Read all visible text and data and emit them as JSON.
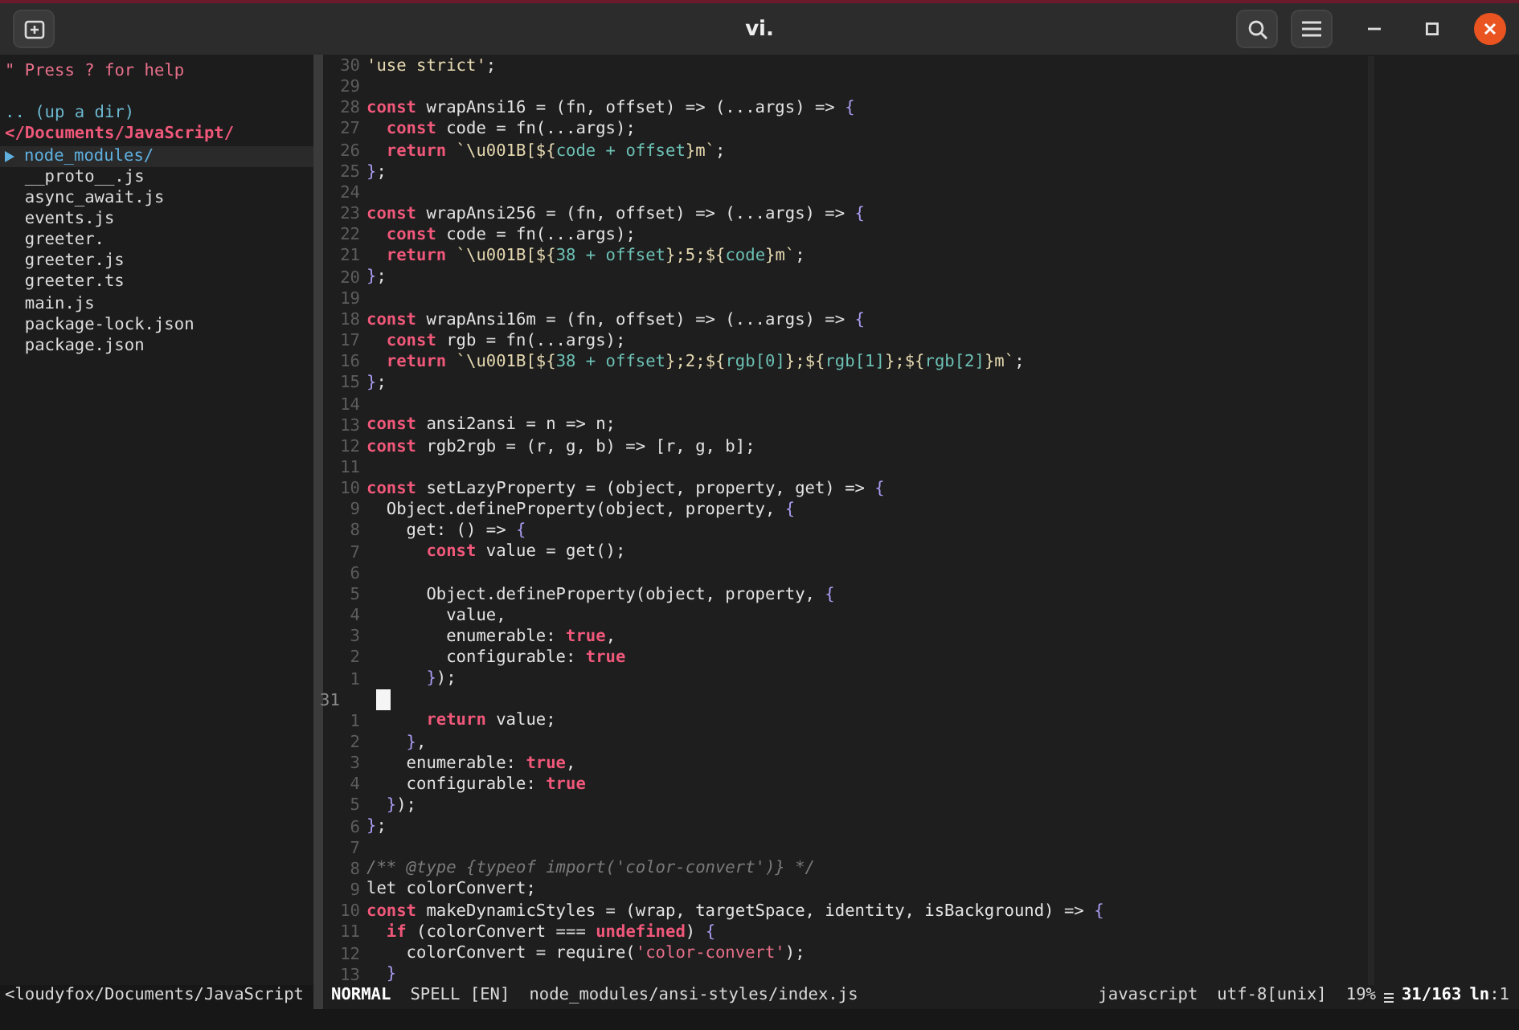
{
  "window": {
    "title": "vi."
  },
  "tree": {
    "help": "\" Press ? for help",
    "up": ".. (up a dir)",
    "root": "</Documents/JavaScript/",
    "items": [
      {
        "name": "node_modules/",
        "kind": "dir",
        "selected": true
      },
      {
        "name": "__proto__.js",
        "kind": "file",
        "selected": false
      },
      {
        "name": "async_await.js",
        "kind": "file",
        "selected": false
      },
      {
        "name": "events.js",
        "kind": "file",
        "selected": false
      },
      {
        "name": "greeter.",
        "kind": "file",
        "selected": false
      },
      {
        "name": "greeter.js",
        "kind": "file",
        "selected": false
      },
      {
        "name": "greeter.ts",
        "kind": "file",
        "selected": false
      },
      {
        "name": "main.js",
        "kind": "file",
        "selected": false
      },
      {
        "name": "package-lock.json",
        "kind": "file",
        "selected": false
      },
      {
        "name": "package.json",
        "kind": "file",
        "selected": false
      }
    ]
  },
  "editor": {
    "lines": [
      {
        "number": "30",
        "cursor": false,
        "tokens": [
          {
            "kind": "str",
            "text": "'use strict'"
          },
          {
            "kind": "pl",
            "text": ";"
          }
        ]
      },
      {
        "number": "29",
        "cursor": false
      },
      {
        "number": "28",
        "cursor": false,
        "tokens": [
          {
            "kind": "kw",
            "text": "const"
          },
          {
            "kind": "pl",
            "text": " wrapAnsi16 = (fn, offset) => (...args) => "
          },
          {
            "kind": "br",
            "text": "{"
          }
        ]
      },
      {
        "number": "27",
        "cursor": false,
        "tokens": [
          {
            "kind": "kw",
            "text": "  const"
          },
          {
            "kind": "pl",
            "text": " code = fn(...args);"
          }
        ]
      },
      {
        "number": "26",
        "cursor": false,
        "tokens": [
          {
            "kind": "kw",
            "text": "  return"
          },
          {
            "kind": "str",
            "text": " `\\u001B[${"
          },
          {
            "kind": "ex",
            "text": "code + offset"
          },
          {
            "kind": "str",
            "text": "}m`"
          },
          {
            "kind": "pl",
            "text": ";"
          }
        ]
      },
      {
        "number": "25",
        "cursor": false,
        "tokens": [
          {
            "kind": "br",
            "text": "}"
          },
          {
            "kind": "pl",
            "text": ";"
          }
        ]
      },
      {
        "number": "24",
        "cursor": false
      },
      {
        "number": "23",
        "cursor": false,
        "tokens": [
          {
            "kind": "kw",
            "text": "const"
          },
          {
            "kind": "pl",
            "text": " wrapAnsi256 = (fn, offset) => (...args) => "
          },
          {
            "kind": "br",
            "text": "{"
          }
        ]
      },
      {
        "number": "22",
        "cursor": false,
        "tokens": [
          {
            "kind": "kw",
            "text": "  const"
          },
          {
            "kind": "pl",
            "text": " code = fn(...args);"
          }
        ]
      },
      {
        "number": "21",
        "cursor": false,
        "tokens": [
          {
            "kind": "kw",
            "text": "  return"
          },
          {
            "kind": "str",
            "text": " `\\u001B[${"
          },
          {
            "kind": "ex",
            "text": "38 + offset"
          },
          {
            "kind": "str",
            "text": "};5;${"
          },
          {
            "kind": "ex",
            "text": "code"
          },
          {
            "kind": "str",
            "text": "}m`"
          },
          {
            "kind": "pl",
            "text": ";"
          }
        ]
      },
      {
        "number": "20",
        "cursor": false,
        "tokens": [
          {
            "kind": "br",
            "text": "}"
          },
          {
            "kind": "pl",
            "text": ";"
          }
        ]
      },
      {
        "number": "19",
        "cursor": false
      },
      {
        "number": "18",
        "cursor": false,
        "tokens": [
          {
            "kind": "kw",
            "text": "const"
          },
          {
            "kind": "pl",
            "text": " wrapAnsi16m = (fn, offset) => (...args) => "
          },
          {
            "kind": "br",
            "text": "{"
          }
        ]
      },
      {
        "number": "17",
        "cursor": false,
        "tokens": [
          {
            "kind": "kw",
            "text": "  const"
          },
          {
            "kind": "pl",
            "text": " rgb = fn(...args);"
          }
        ]
      },
      {
        "number": "16",
        "cursor": false,
        "tokens": [
          {
            "kind": "kw",
            "text": "  return"
          },
          {
            "kind": "str",
            "text": " `\\u001B[${"
          },
          {
            "kind": "ex",
            "text": "38 + offset"
          },
          {
            "kind": "str",
            "text": "};2;${"
          },
          {
            "kind": "ex",
            "text": "rgb[0]"
          },
          {
            "kind": "str",
            "text": "};${"
          },
          {
            "kind": "ex",
            "text": "rgb[1]"
          },
          {
            "kind": "str",
            "text": "};${"
          },
          {
            "kind": "ex",
            "text": "rgb[2]"
          },
          {
            "kind": "str",
            "text": "}m`"
          },
          {
            "kind": "pl",
            "text": ";"
          }
        ]
      },
      {
        "number": "15",
        "cursor": false,
        "tokens": [
          {
            "kind": "br",
            "text": "}"
          },
          {
            "kind": "pl",
            "text": ";"
          }
        ]
      },
      {
        "number": "14",
        "cursor": false
      },
      {
        "number": "13",
        "cursor": false,
        "tokens": [
          {
            "kind": "kw",
            "text": "const"
          },
          {
            "kind": "pl",
            "text": " ansi2ansi = n => n;"
          }
        ]
      },
      {
        "number": "12",
        "cursor": false,
        "tokens": [
          {
            "kind": "kw",
            "text": "const"
          },
          {
            "kind": "pl",
            "text": " rgb2rgb = (r, g, b) => [r, g, b];"
          }
        ]
      },
      {
        "number": "11",
        "cursor": false
      },
      {
        "number": "10",
        "cursor": false,
        "tokens": [
          {
            "kind": "kw",
            "text": "const"
          },
          {
            "kind": "pl",
            "text": " setLazyProperty = (object, property, get) => "
          },
          {
            "kind": "br",
            "text": "{"
          }
        ]
      },
      {
        "number": "9",
        "cursor": false,
        "tokens": [
          {
            "kind": "pl",
            "text": "  Object.defineProperty(object, property, "
          },
          {
            "kind": "br",
            "text": "{"
          }
        ]
      },
      {
        "number": "8",
        "cursor": false,
        "tokens": [
          {
            "kind": "pl",
            "text": "    get: () => "
          },
          {
            "kind": "br",
            "text": "{"
          }
        ]
      },
      {
        "number": "7",
        "cursor": false,
        "tokens": [
          {
            "kind": "kw",
            "text": "      const"
          },
          {
            "kind": "pl",
            "text": " value = get();"
          }
        ]
      },
      {
        "number": "6",
        "cursor": false
      },
      {
        "number": "5",
        "cursor": false,
        "tokens": [
          {
            "kind": "pl",
            "text": "      Object.defineProperty(object, property, "
          },
          {
            "kind": "br",
            "text": "{"
          }
        ]
      },
      {
        "number": "4",
        "cursor": false,
        "tokens": [
          {
            "kind": "pl",
            "text": "        value,"
          }
        ]
      },
      {
        "number": "3",
        "cursor": false,
        "tokens": [
          {
            "kind": "pl",
            "text": "        enumerable: "
          },
          {
            "kind": "kw",
            "text": "true"
          },
          {
            "kind": "pl",
            "text": ","
          }
        ]
      },
      {
        "number": "2",
        "cursor": false,
        "tokens": [
          {
            "kind": "pl",
            "text": "        configurable: "
          },
          {
            "kind": "kw",
            "text": "true"
          }
        ]
      },
      {
        "number": "1",
        "cursor": false,
        "tokens": [
          {
            "kind": "br",
            "text": "      }"
          },
          {
            "kind": "pl",
            "text": ");"
          }
        ]
      },
      {
        "number": "31",
        "cursor": true
      },
      {
        "number": "1",
        "cursor": false,
        "tokens": [
          {
            "kind": "kw",
            "text": "      return"
          },
          {
            "kind": "pl",
            "text": " value;"
          }
        ]
      },
      {
        "number": "2",
        "cursor": false,
        "tokens": [
          {
            "kind": "br",
            "text": "    }"
          },
          {
            "kind": "pl",
            "text": ","
          }
        ]
      },
      {
        "number": "3",
        "cursor": false,
        "tokens": [
          {
            "kind": "pl",
            "text": "    enumerable: "
          },
          {
            "kind": "kw",
            "text": "true"
          },
          {
            "kind": "pl",
            "text": ","
          }
        ]
      },
      {
        "number": "4",
        "cursor": false,
        "tokens": [
          {
            "kind": "pl",
            "text": "    configurable: "
          },
          {
            "kind": "kw",
            "text": "true"
          }
        ]
      },
      {
        "number": "5",
        "cursor": false,
        "tokens": [
          {
            "kind": "br",
            "text": "  }"
          },
          {
            "kind": "pl",
            "text": ");"
          }
        ]
      },
      {
        "number": "6",
        "cursor": false,
        "tokens": [
          {
            "kind": "br",
            "text": "}"
          },
          {
            "kind": "pl",
            "text": ";"
          }
        ]
      },
      {
        "number": "7",
        "cursor": false
      },
      {
        "number": "8",
        "cursor": false,
        "tokens": [
          {
            "kind": "cm",
            "text": "/** @type {typeof import('color-convert')} */"
          }
        ]
      },
      {
        "number": "9",
        "cursor": false,
        "tokens": [
          {
            "kind": "pl",
            "text": "let colorConvert;"
          }
        ]
      },
      {
        "number": "10",
        "cursor": false,
        "tokens": [
          {
            "kind": "kw",
            "text": "const"
          },
          {
            "kind": "pl",
            "text": " makeDynamicStyles = (wrap, targetSpace, identity, isBackground) => "
          },
          {
            "kind": "br",
            "text": "{"
          }
        ]
      },
      {
        "number": "11",
        "cursor": false,
        "tokens": [
          {
            "kind": "kw",
            "text": "  if"
          },
          {
            "kind": "pl",
            "text": " (colorConvert === "
          },
          {
            "kind": "kw",
            "text": "undefined"
          },
          {
            "kind": "pl",
            "text": ") "
          },
          {
            "kind": "br",
            "text": "{"
          }
        ]
      },
      {
        "number": "12",
        "cursor": false,
        "tokens": [
          {
            "kind": "pl",
            "text": "    colorConvert = require("
          },
          {
            "kind": "rs",
            "text": "'color-convert'"
          },
          {
            "kind": "pl",
            "text": ");"
          }
        ]
      },
      {
        "number": "13",
        "cursor": false,
        "tokens": [
          {
            "kind": "br",
            "text": "  }"
          }
        ]
      }
    ]
  },
  "status_bar": {
    "tree_path": "<loudyfox/Documents/JavaScript",
    "mode": "NORMAL",
    "spell": "SPELL [EN]",
    "file": "node_modules/ansi-styles/index.js",
    "filetype": "javascript",
    "encoding": "utf-8[unix]",
    "percent": "19%",
    "position": "31/163",
    "ln_label": "ln",
    "column": ":1"
  }
}
